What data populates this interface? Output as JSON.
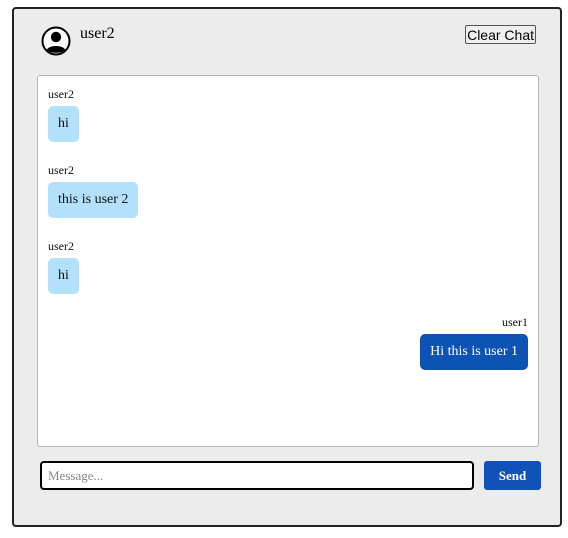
{
  "header": {
    "username": "user2",
    "avatar_icon": "user-avatar-icon",
    "clear_label": "Clear Chat"
  },
  "messages": [
    {
      "sender": "user2",
      "text": "hi",
      "side": "left"
    },
    {
      "sender": "user2",
      "text": "this is user 2",
      "side": "left"
    },
    {
      "sender": "user2",
      "text": "hi",
      "side": "left"
    },
    {
      "sender": "user1",
      "text": "Hi this is user 1",
      "side": "right"
    }
  ],
  "composer": {
    "placeholder": "Message...",
    "value": "",
    "send_label": "Send"
  },
  "colors": {
    "incoming_bubble": "#b3e0fb",
    "outgoing_bubble": "#0d53b4",
    "send_button": "#1152b8"
  }
}
